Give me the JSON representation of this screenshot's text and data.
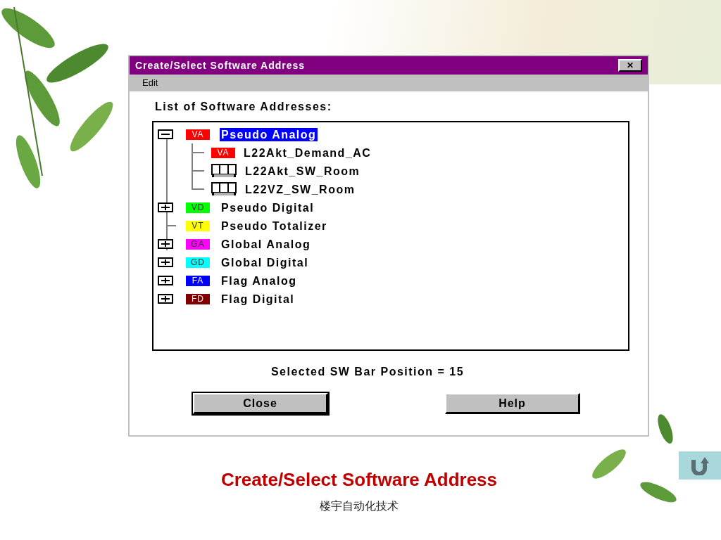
{
  "window": {
    "title": "Create/Select Software Address",
    "close_glyph": "✕"
  },
  "menu": [
    {
      "label": "Edit"
    }
  ],
  "list_label": "List of Software Addresses:",
  "tree": [
    {
      "label": "Pseudo Analog",
      "kind": "group",
      "expanded": true,
      "selected": true,
      "badge": "VA",
      "color": "#ff0000",
      "children": [
        {
          "label": "L22Akt_Demand_AC",
          "kind": "badge",
          "badge": "VA",
          "color": "#ff0000",
          "selected": false
        },
        {
          "label": "L22Akt_SW_Room",
          "kind": "bar",
          "selected": false
        },
        {
          "label": "L22VZ_SW_Room",
          "kind": "bar",
          "selected": false
        }
      ]
    },
    {
      "label": "Pseudo Digital",
      "kind": "group",
      "expanded": false,
      "selected": false,
      "badge": "VD",
      "color": "#00ff00"
    },
    {
      "label": "Pseudo Totalizer",
      "kind": "item",
      "selected": false,
      "badge": "VT",
      "color": "#ffff00"
    },
    {
      "label": "Global Analog",
      "kind": "group",
      "expanded": false,
      "selected": false,
      "badge": "GA",
      "color": "#ff00ff"
    },
    {
      "label": "Global Digital",
      "kind": "group",
      "expanded": false,
      "selected": false,
      "badge": "GD",
      "color": "#00ffff"
    },
    {
      "label": "Flag Analog",
      "kind": "group",
      "expanded": false,
      "selected": false,
      "badge": "FA",
      "color": "#0000ff"
    },
    {
      "label": "Flag Digital",
      "kind": "group",
      "expanded": false,
      "selected": false,
      "badge": "FD",
      "color": "#800000"
    }
  ],
  "status_text": "Selected SW Bar Position = 15",
  "buttons": [
    {
      "label": "Close",
      "default": true
    },
    {
      "label": "Help",
      "default": false
    }
  ],
  "slide": {
    "title": "Create/Select Software Address",
    "subtitle": "楼宇自动化技术"
  }
}
